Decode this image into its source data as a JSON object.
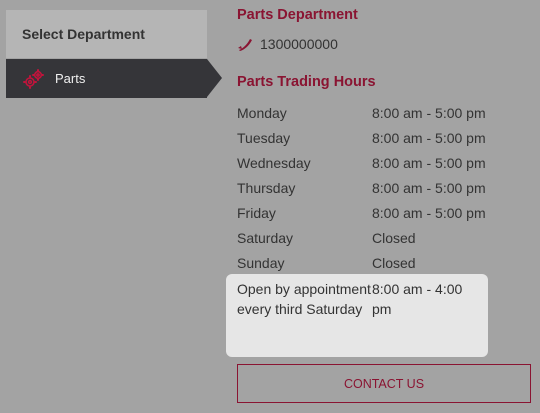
{
  "sidebar": {
    "header": "Select Department",
    "items": [
      {
        "label": "Parts",
        "icon": "gears-icon"
      }
    ]
  },
  "department": {
    "title": "Parts Department",
    "phone": "1300000000",
    "phone_icon": "phone-icon"
  },
  "hours": {
    "title": "Parts Trading Hours",
    "rows": [
      {
        "day": "Monday",
        "time": "8:00 am - 5:00 pm"
      },
      {
        "day": "Tuesday",
        "time": "8:00 am - 5:00 pm"
      },
      {
        "day": "Wednesday",
        "time": "8:00 am - 5:00 pm"
      },
      {
        "day": "Thursday",
        "time": "8:00 am - 5:00 pm"
      },
      {
        "day": "Friday",
        "time": "8:00 am - 5:00 pm"
      },
      {
        "day": "Saturday",
        "time": "Closed"
      },
      {
        "day": "Sunday",
        "time": "Closed"
      }
    ],
    "special": {
      "day": "Open by appointment every third Saturday",
      "time": "8:00 am - 4:00 pm"
    }
  },
  "contact_button": "CONTACT US",
  "colors": {
    "accent": "#8a1432",
    "sidebar_active": "#353539",
    "background": "#a3a3a3"
  }
}
